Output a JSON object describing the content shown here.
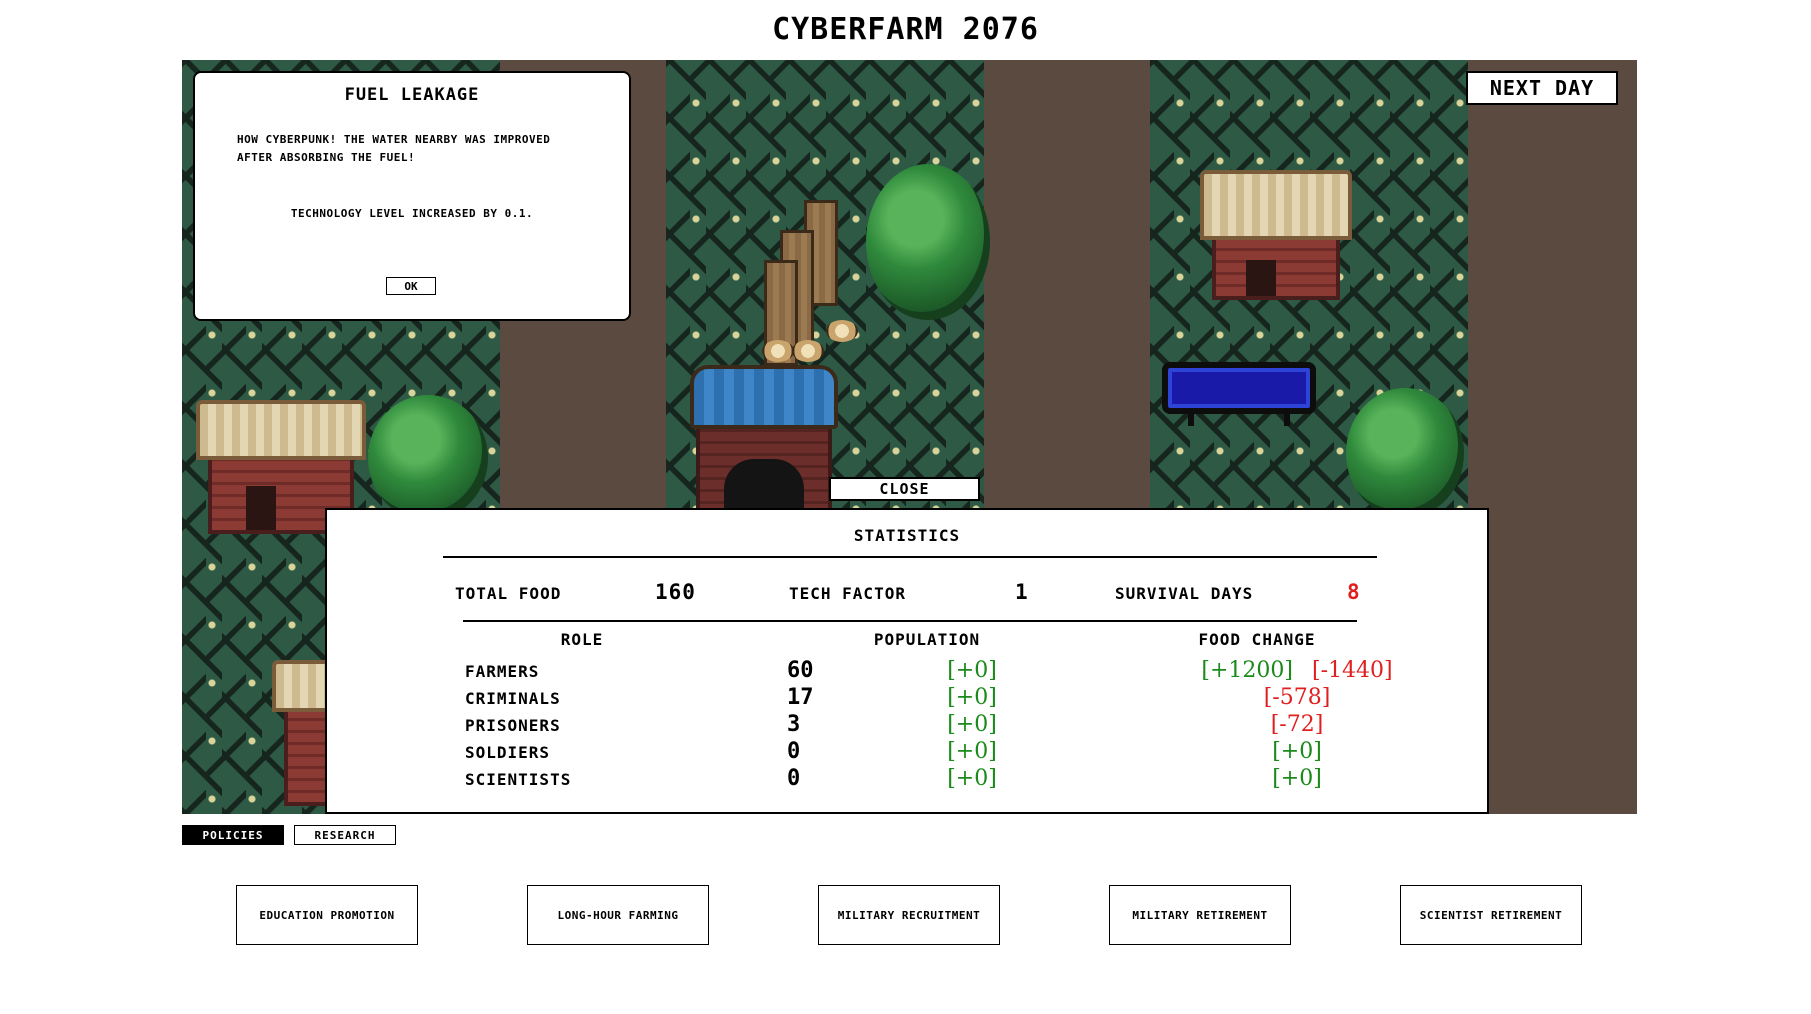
{
  "title": "CYBERFARM 2076",
  "event": {
    "title": "FUEL LEAKAGE",
    "message": "HOW CYBERPUNK! THE WATER NEARBY WAS IMPROVED AFTER ABSORBING THE FUEL!",
    "result": "TECHNOLOGY LEVEL INCREASED BY 0.1.",
    "ok_label": "OK"
  },
  "next_day_label": "NEXT DAY",
  "close_label": "CLOSE",
  "statistics": {
    "title": "STATISTICS",
    "total_food_label": "TOTAL FOOD",
    "total_food": "160",
    "tech_factor_label": "TECH FACTOR",
    "tech_factor": "1",
    "survival_days_label": "SURVIVAL DAYS",
    "survival_days": "8",
    "headers": {
      "role": "ROLE",
      "population": "POPULATION",
      "food_change": "FOOD CHANGE"
    },
    "rows": [
      {
        "role": "FARMERS",
        "population": "60",
        "pop_change": "[+0]",
        "food_gain": "[+1200]",
        "food_loss": "[-1440]"
      },
      {
        "role": "CRIMINALS",
        "population": "17",
        "pop_change": "[+0]",
        "food_loss": "[-578]"
      },
      {
        "role": "PRISONERS",
        "population": "3",
        "pop_change": "[+0]",
        "food_loss": "[-72]"
      },
      {
        "role": "SOLDIERS",
        "population": "0",
        "pop_change": "[+0]",
        "food_gain": "[+0]"
      },
      {
        "role": "SCIENTISTS",
        "population": "0",
        "pop_change": "[+0]",
        "food_gain": "[+0]"
      }
    ]
  },
  "tabs": {
    "policies": "POLICIES",
    "research": "RESEARCH",
    "active": "policies"
  },
  "policies": [
    "EDUCATION PROMOTION",
    "LONG-HOUR FARMING",
    "MILITARY RECRUITMENT",
    "MILITARY RETIREMENT",
    "SCIENTIST RETIREMENT"
  ],
  "colors": {
    "gain": "#1a8a1a",
    "loss": "#e02020",
    "grass": "#2e5a45",
    "dirt": "#5b4a3f"
  }
}
